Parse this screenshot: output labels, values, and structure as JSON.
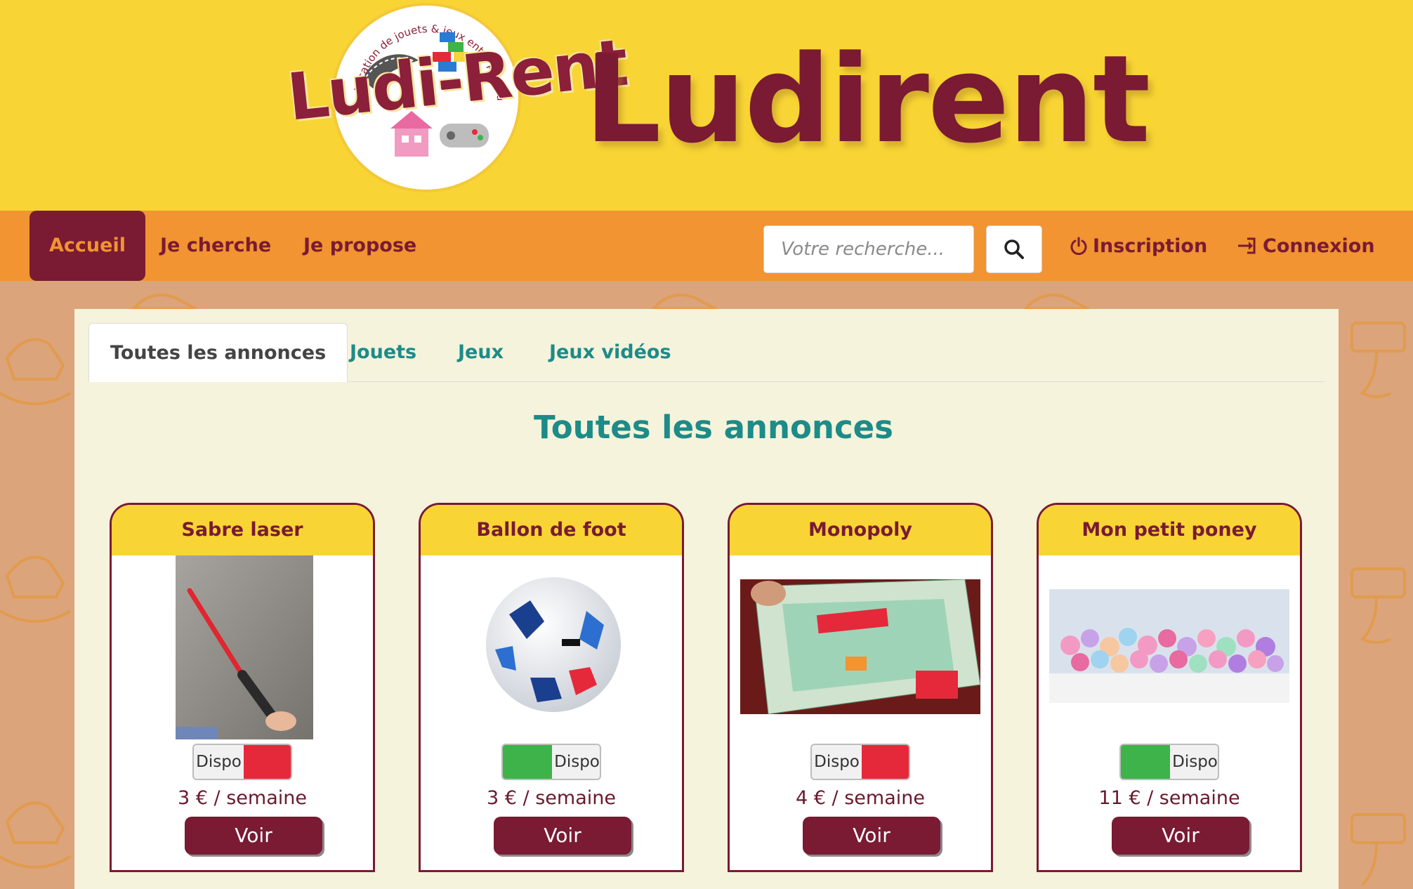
{
  "header": {
    "logo_text": "Ludi-Rent",
    "logo_tagline": "Location de jouets & jeux entre particuliers",
    "site_title": "Ludirent"
  },
  "nav": {
    "items": [
      {
        "label": "Accueil",
        "active": true
      },
      {
        "label": "Je cherche",
        "active": false
      },
      {
        "label": "Je propose",
        "active": false
      }
    ],
    "search_placeholder": "Votre recherche...",
    "inscription": "Inscription",
    "connexion": "Connexion"
  },
  "tabs": [
    {
      "label": "Toutes les annonces",
      "active": true
    },
    {
      "label": "Jouets",
      "active": false
    },
    {
      "label": "Jeux",
      "active": false
    },
    {
      "label": "Jeux vidéos",
      "active": false
    }
  ],
  "section_title": "Toutes les annonces",
  "cards": [
    {
      "title": "Sabre laser",
      "available": false,
      "toggle_label": "Dispo",
      "price": "3 € / semaine",
      "button": "Voir",
      "image": "lightsaber-photo"
    },
    {
      "title": "Ballon de foot",
      "available": true,
      "toggle_label": "Dispo",
      "price": "3 € / semaine",
      "button": "Voir",
      "image": "football-photo"
    },
    {
      "title": "Monopoly",
      "available": false,
      "toggle_label": "Dispo",
      "price": "4 € / semaine",
      "button": "Voir",
      "image": "monopoly-board-photo"
    },
    {
      "title": "Mon petit poney",
      "available": true,
      "toggle_label": "Dispo",
      "price": "11 € / semaine",
      "button": "Voir",
      "image": "ponies-collection-photo"
    }
  ],
  "colors": {
    "header_yellow": "#f8d534",
    "nav_orange": "#f19431",
    "brand_bordeaux": "#7a1a33",
    "teal": "#1d8b88",
    "panel_cream": "#f5f3dc",
    "toggle_on_green": "#3db34a",
    "toggle_off_red": "#e5293a"
  }
}
